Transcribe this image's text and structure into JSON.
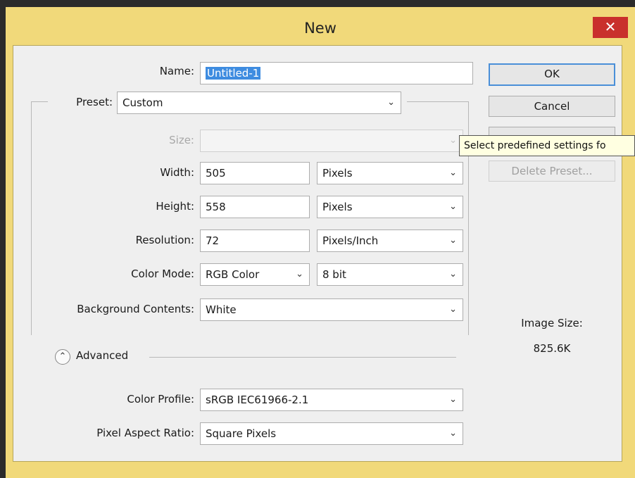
{
  "window": {
    "title": "New",
    "close_label": "✕"
  },
  "form": {
    "name_label": "Name:",
    "name_value": "Untitled-1",
    "preset_label": "Preset:",
    "preset_value": "Custom",
    "size_label": "Size:",
    "size_value": "",
    "width_label": "Width:",
    "width_value": "505",
    "width_unit": "Pixels",
    "height_label": "Height:",
    "height_value": "558",
    "height_unit": "Pixels",
    "resolution_label": "Resolution:",
    "resolution_value": "72",
    "resolution_unit": "Pixels/Inch",
    "color_mode_label": "Color Mode:",
    "color_mode_value": "RGB Color",
    "bit_depth_value": "8 bit",
    "background_label": "Background Contents:",
    "background_value": "White",
    "advanced_label": "Advanced",
    "color_profile_label": "Color Profile:",
    "color_profile_value": "sRGB IEC61966-2.1",
    "pixel_aspect_label": "Pixel Aspect Ratio:",
    "pixel_aspect_value": "Square Pixels"
  },
  "buttons": {
    "ok": "OK",
    "cancel": "Cancel",
    "delete_preset": "Delete Preset..."
  },
  "tooltip": {
    "text": "Select predefined settings fo"
  },
  "info": {
    "image_size_label": "Image Size:",
    "image_size_value": "825.6K"
  }
}
